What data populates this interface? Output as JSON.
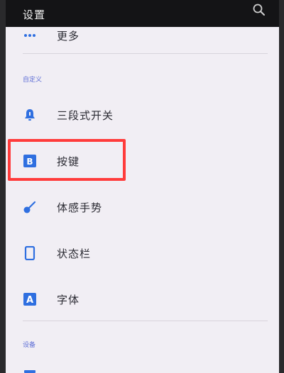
{
  "header": {
    "title": "设置"
  },
  "more_item": {
    "label": "更多"
  },
  "sections": {
    "custom": "自定义",
    "device": "设备"
  },
  "items": [
    {
      "label": "三段式开关",
      "icon": "bell-icon"
    },
    {
      "label": "按键",
      "icon": "key-b-icon"
    },
    {
      "label": "体感手势",
      "icon": "gesture-icon"
    },
    {
      "label": "状态栏",
      "icon": "phone-icon"
    },
    {
      "label": "字体",
      "icon": "font-a-icon"
    }
  ],
  "colors": {
    "accent": "#2f6fe0",
    "highlight": "#ff3b3b"
  }
}
